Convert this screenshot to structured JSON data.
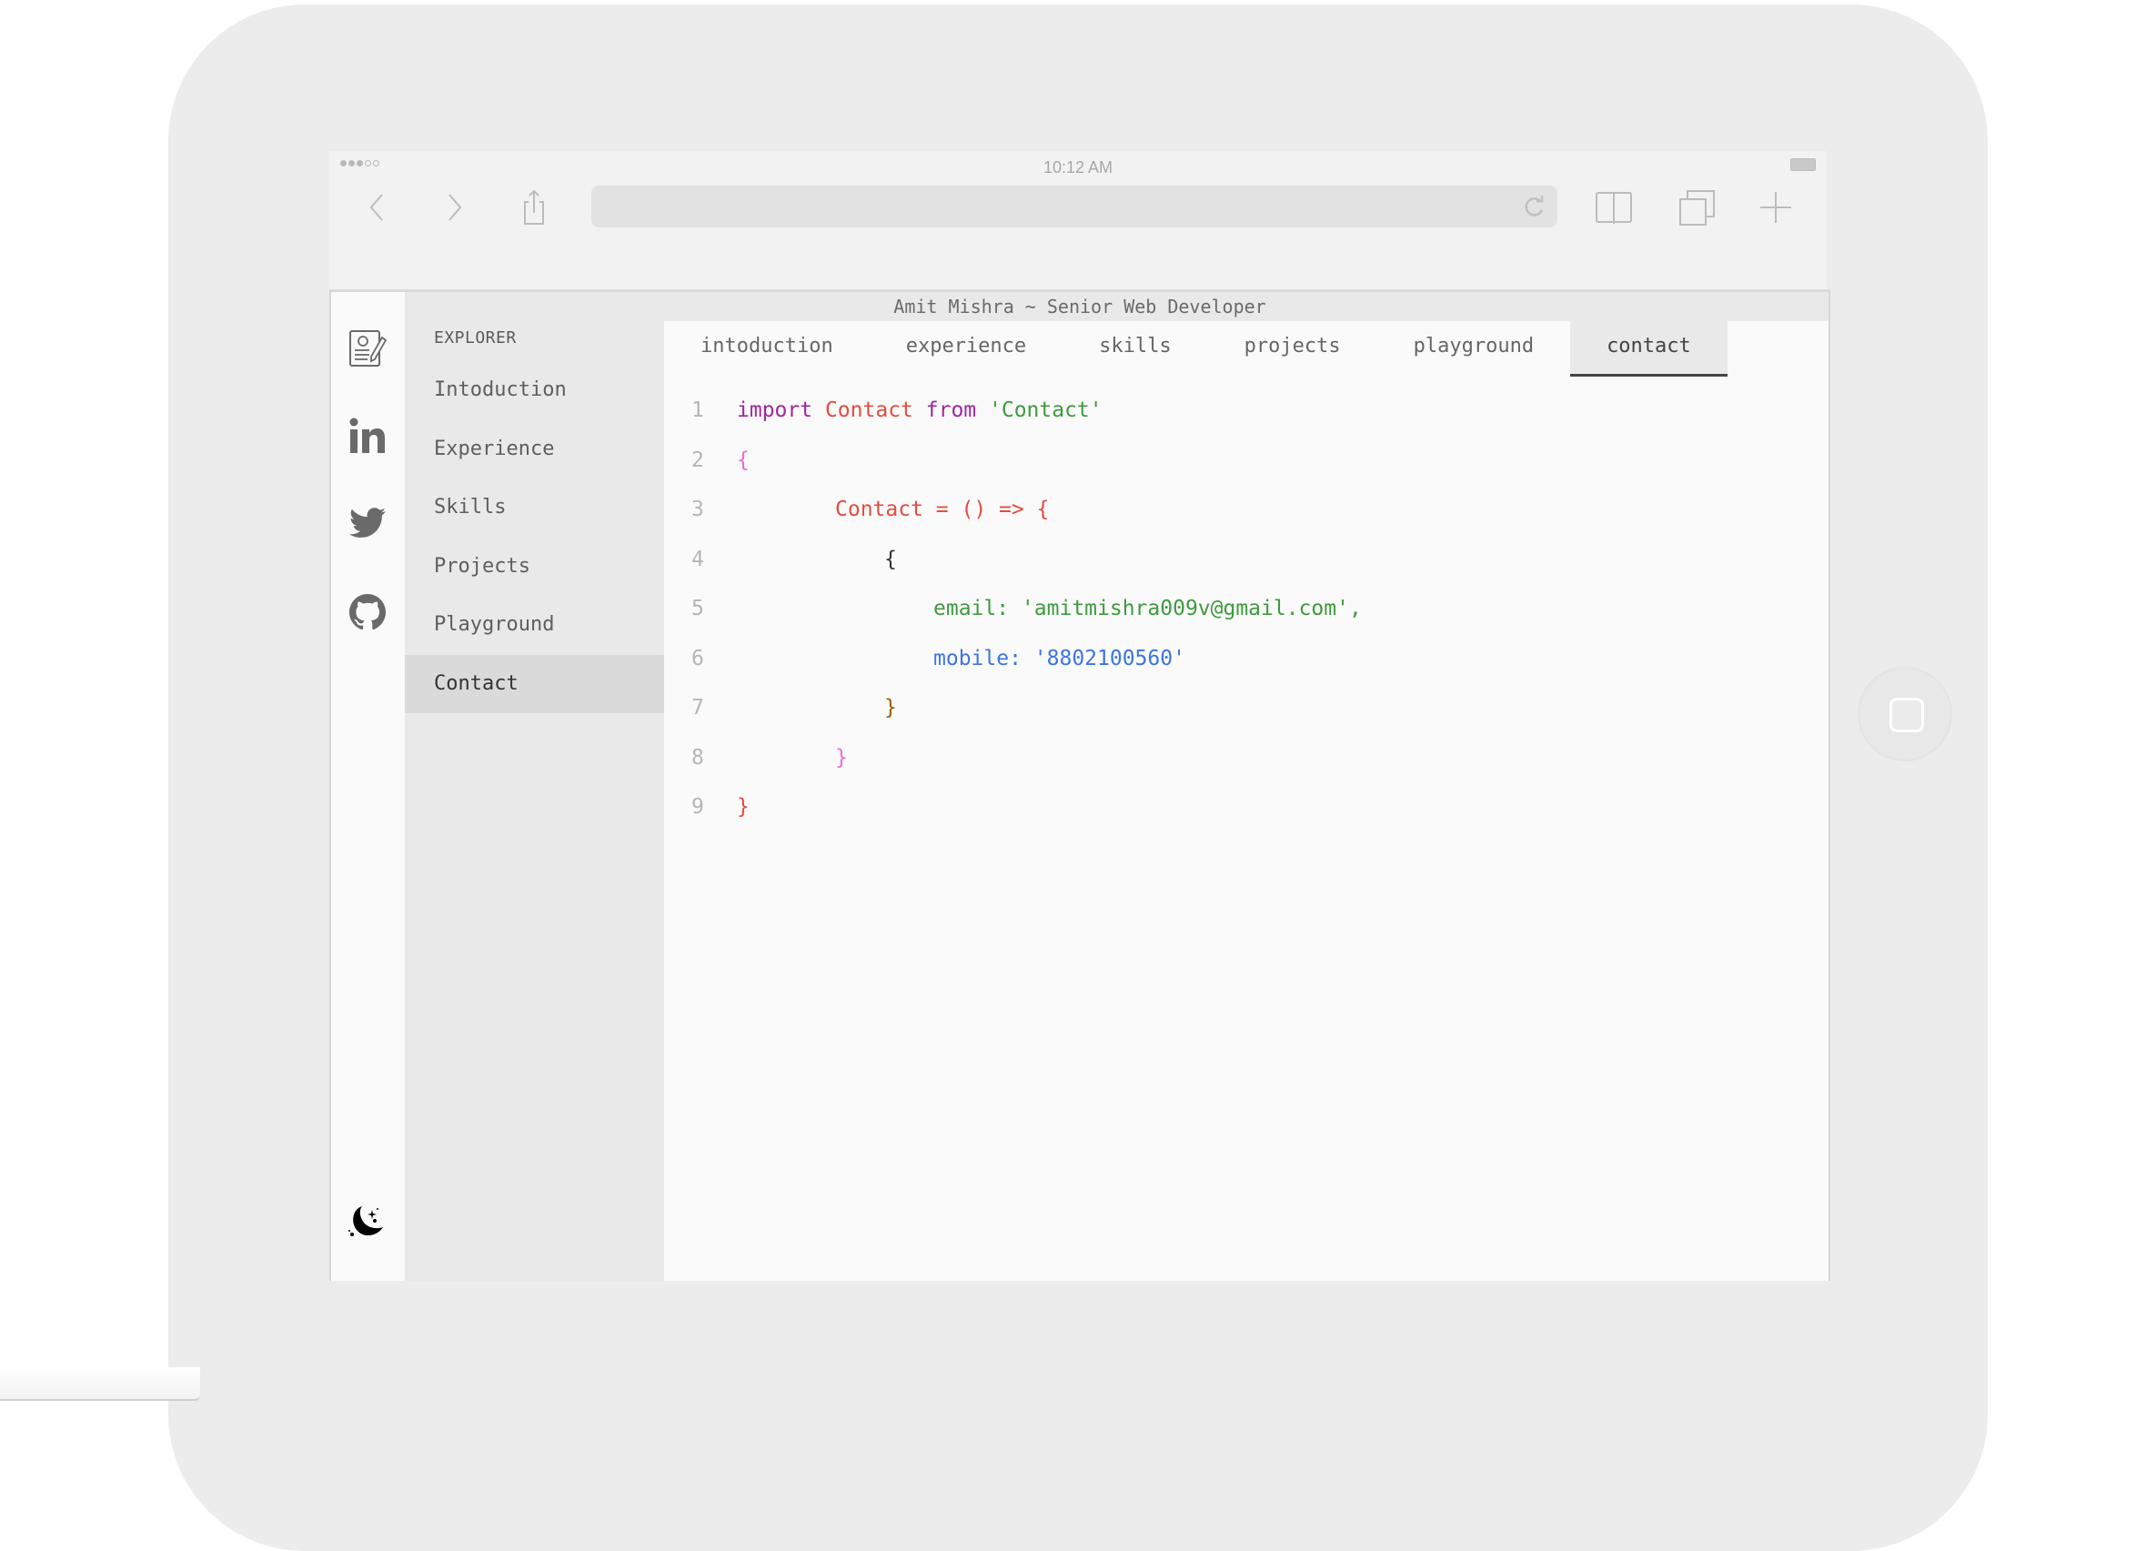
{
  "device": {
    "status_bar": {
      "time": "10:12 AM",
      "signal_bars_filled": 3,
      "signal_bars_total": 5
    },
    "browser": {
      "buttons": [
        {
          "name": "back",
          "icon": "chevron-left-icon"
        },
        {
          "name": "forward",
          "icon": "chevron-right-icon"
        },
        {
          "name": "share",
          "icon": "share-icon"
        },
        {
          "name": "bookmarks",
          "icon": "book-icon"
        },
        {
          "name": "tabs",
          "icon": "tabs-icon"
        },
        {
          "name": "new-tab",
          "icon": "plus-icon"
        }
      ],
      "url": "",
      "reload_icon": "reload-icon"
    }
  },
  "app": {
    "title": "Amit Mishra ~ Senior Web Developer",
    "iconbar": [
      {
        "name": "resume",
        "icon": "resume-icon"
      },
      {
        "name": "linkedin",
        "icon": "linkedin-icon"
      },
      {
        "name": "twitter",
        "icon": "twitter-icon"
      },
      {
        "name": "github",
        "icon": "github-icon"
      }
    ],
    "theme_toggle_icon": "moon-icon",
    "explorer": {
      "header": "EXPLORER",
      "items": [
        {
          "label": "Intoduction",
          "active": false
        },
        {
          "label": "Experience",
          "active": false
        },
        {
          "label": "Skills",
          "active": false
        },
        {
          "label": "Projects",
          "active": false
        },
        {
          "label": "Playground",
          "active": false
        },
        {
          "label": "Contact",
          "active": true
        }
      ]
    },
    "tabs": [
      {
        "label": "intoduction",
        "active": false
      },
      {
        "label": "experience",
        "active": false
      },
      {
        "label": "skills",
        "active": false
      },
      {
        "label": "projects",
        "active": false
      },
      {
        "label": "playground",
        "active": false
      },
      {
        "label": "contact",
        "active": true
      }
    ],
    "code": {
      "lines": [
        {
          "n": "1",
          "tokens": [
            [
              "kw",
              "import"
            ],
            [
              "dark",
              " "
            ],
            [
              "red",
              "Contact"
            ],
            [
              "dark",
              " "
            ],
            [
              "kw",
              "from"
            ],
            [
              "dark",
              " "
            ],
            [
              "str",
              "'Contact'"
            ]
          ],
          "indent": 0
        },
        {
          "n": "2",
          "tokens": [
            [
              "pink",
              "{"
            ]
          ],
          "indent": 0
        },
        {
          "n": "3",
          "tokens": [
            [
              "red",
              "Contact = () => {"
            ]
          ],
          "indent": 2
        },
        {
          "n": "4",
          "tokens": [
            [
              "dark",
              "{"
            ]
          ],
          "indent": 3
        },
        {
          "n": "5",
          "tokens": [
            [
              "str",
              "email: 'amitmishra009v@gmail.com',"
            ]
          ],
          "indent": 4
        },
        {
          "n": "6",
          "tokens": [
            [
              "blue",
              "mobile: "
            ],
            [
              "blue",
              "'8802100560'"
            ]
          ],
          "indent": 4
        },
        {
          "n": "7",
          "tokens": [
            [
              "brown",
              "}"
            ]
          ],
          "indent": 3
        },
        {
          "n": "8",
          "tokens": [
            [
              "pink",
              "}"
            ]
          ],
          "indent": 2
        },
        {
          "n": "9",
          "tokens": [
            [
              "red",
              "}"
            ]
          ],
          "indent": 0
        }
      ]
    }
  }
}
